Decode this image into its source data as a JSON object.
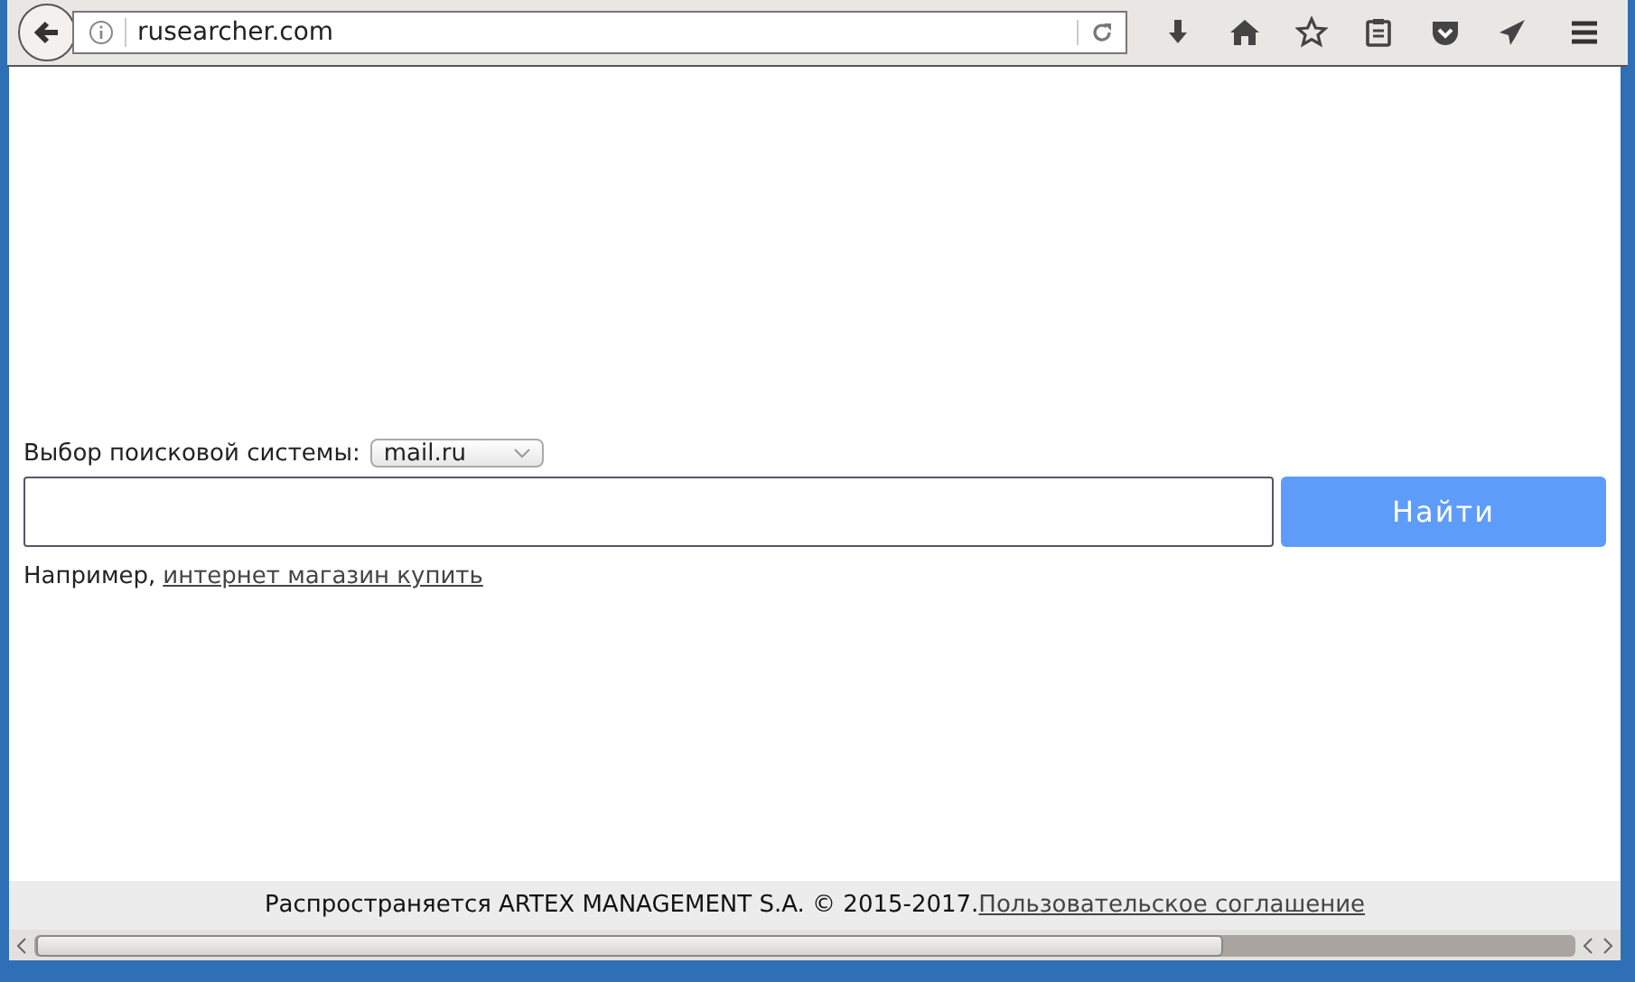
{
  "browser": {
    "url": "rusearcher.com"
  },
  "search": {
    "engine_label": "Выбор поисковой системы:",
    "engine": "mail.ru",
    "button": "Найти",
    "example_label": "Например,",
    "example_link": "интернет магазин купить"
  },
  "footer": {
    "text": "Распространяется ARTEX MANAGEMENT S.A. © 2015-2017.",
    "link": "Пользовательское соглашение"
  }
}
